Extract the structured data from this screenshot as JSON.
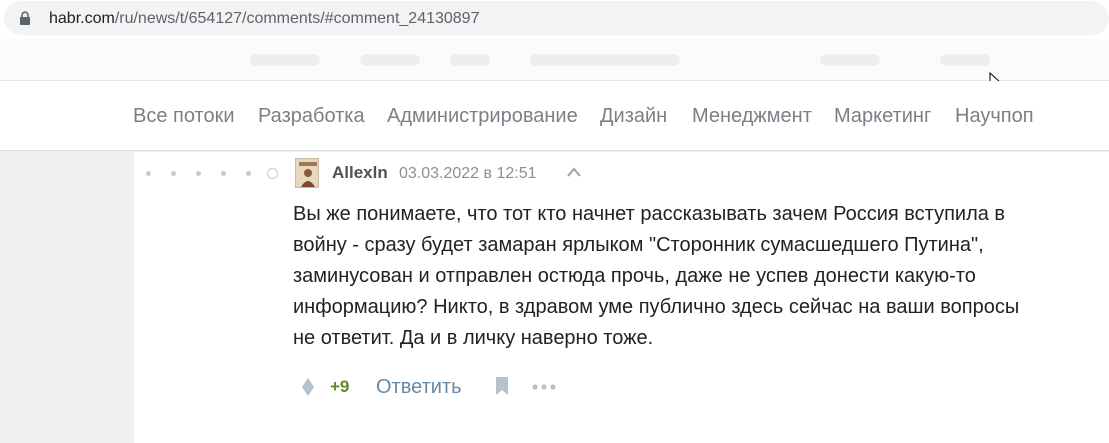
{
  "browser": {
    "url_host": "habr.com",
    "url_path": "/ru/news/t/654127/comments/#comment_24130897"
  },
  "nav": {
    "items": [
      {
        "label": "Все потоки"
      },
      {
        "label": "Разработка"
      },
      {
        "label": "Администрирование"
      },
      {
        "label": "Дизайн"
      },
      {
        "label": "Менеджмент"
      },
      {
        "label": "Маркетинг"
      },
      {
        "label": "Научпоп"
      }
    ]
  },
  "comment": {
    "author": "Allexln",
    "date": "03.03.2022 в 12:51",
    "lines": [
      "Вы же понимаете, что тот кто начнет рассказывать зачем Россия вступила в",
      "войну - сразу будет замаран ярлыком \"Сторонник сумасшедшего Путина\",",
      "заминусован и отправлен остюда прочь, даже не успев донести какую-то",
      "информацию? Никто, в здравом уме публично здесь сейчас на ваши вопросы",
      "не ответит. Да и в личку наверно тоже."
    ],
    "score": "+9",
    "reply_label": "Ответить"
  },
  "icons": {
    "lock": "lock-icon",
    "vote": "vote-diamond-icon",
    "bookmark": "bookmark-icon",
    "more": "more-dots-icon",
    "collapse": "chevron-up-icon"
  },
  "colors": {
    "score": "#5b8a1f",
    "reply_link": "#6789a7",
    "nav_text": "#7a8086"
  }
}
